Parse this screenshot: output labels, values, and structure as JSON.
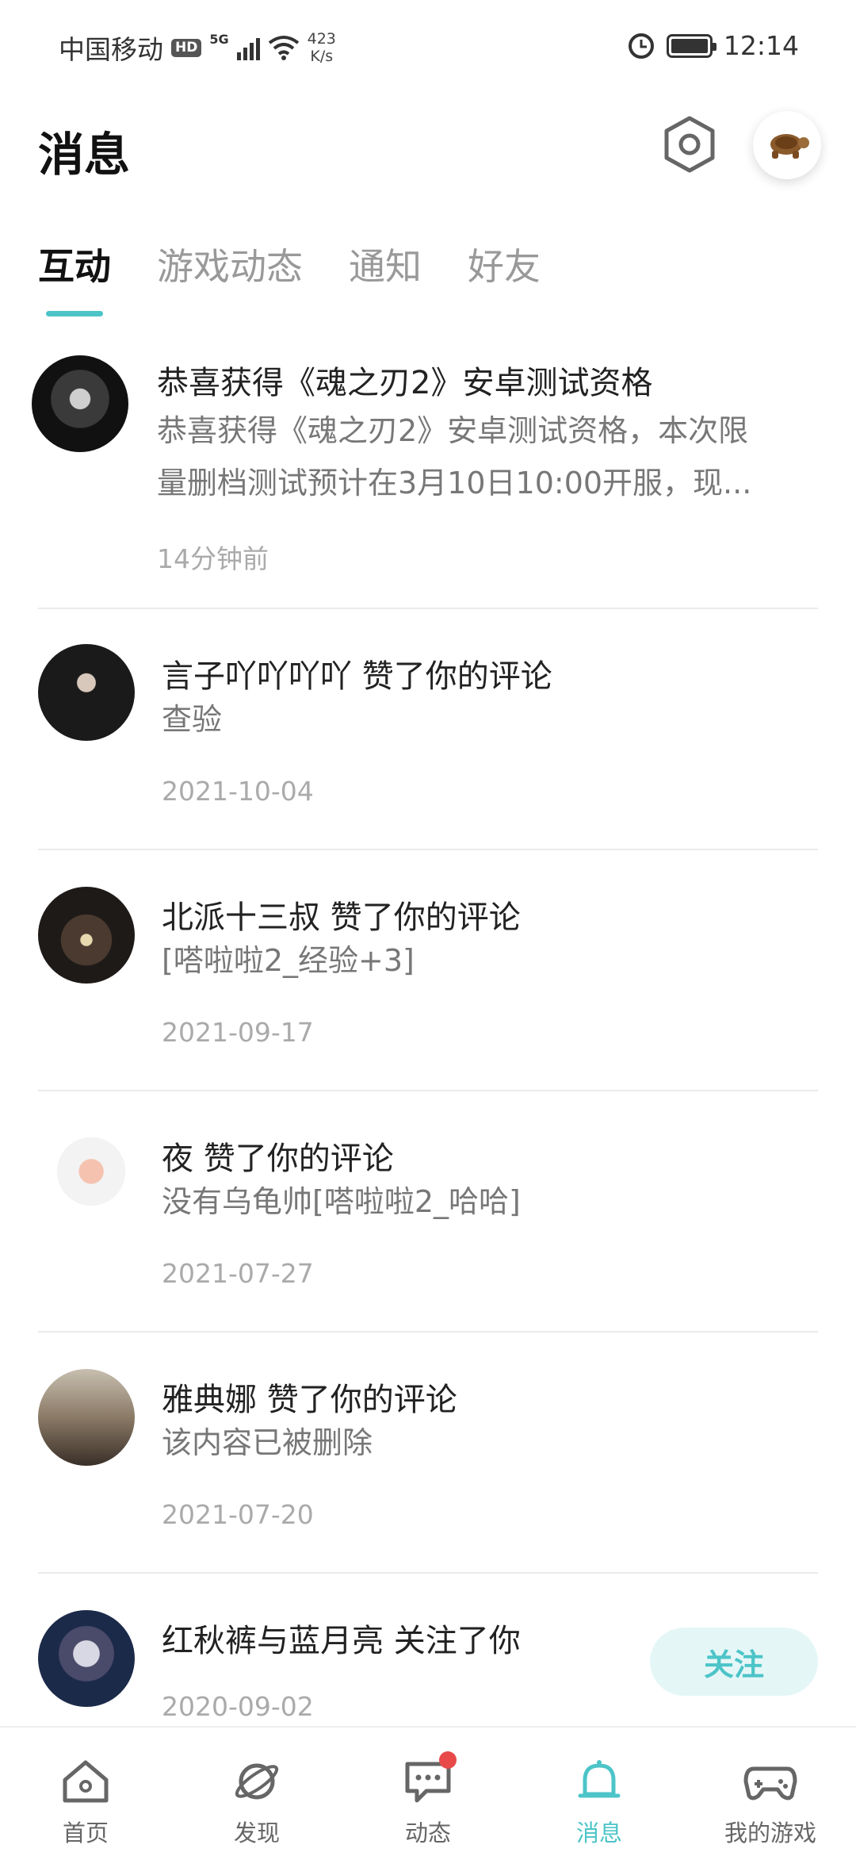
{
  "status_bar": {
    "carrier": "中国移动",
    "hd": "HD",
    "network": "5G",
    "speed_value": "423",
    "speed_unit": "K/s",
    "time": "12:14"
  },
  "header": {
    "title": "消息"
  },
  "tabs": [
    {
      "label": "互动",
      "active": true
    },
    {
      "label": "游戏动态",
      "active": false
    },
    {
      "label": "通知",
      "active": false
    },
    {
      "label": "好友",
      "active": false
    }
  ],
  "messages": [
    {
      "title": "恭喜获得《魂之刃2》安卓测试资格",
      "body_line1": "恭喜获得《魂之刃2》安卓测试资格，本次限",
      "body_line2": "量删档测试预计在3月10日10:00开服，现...",
      "time": "14分钟前"
    },
    {
      "title": "言子吖吖吖吖 赞了你的评论",
      "body": "查验",
      "time": "2021-10-04"
    },
    {
      "title": "北派十三叔 赞了你的评论",
      "body": "[嗒啦啦2_经验+3]",
      "time": "2021-09-17"
    },
    {
      "title": "夜 赞了你的评论",
      "body": "没有乌龟帅[嗒啦啦2_哈哈]",
      "time": "2021-07-27"
    },
    {
      "title": "雅典娜 赞了你的评论",
      "body": "该内容已被删除",
      "time": "2021-07-20"
    },
    {
      "title": "红秋裤与蓝月亮 关注了你",
      "time": "2020-09-02",
      "action": "关注"
    }
  ],
  "bottom_nav": [
    {
      "label": "首页",
      "icon": "home-icon",
      "active": false
    },
    {
      "label": "发现",
      "icon": "planet-icon",
      "active": false
    },
    {
      "label": "动态",
      "icon": "chat-icon",
      "active": false,
      "badge": true
    },
    {
      "label": "消息",
      "icon": "bell-icon",
      "active": true
    },
    {
      "label": "我的游戏",
      "icon": "gamepad-icon",
      "active": false
    }
  ],
  "colors": {
    "accent": "#4cc4c8",
    "badge": "#e84a4a"
  }
}
